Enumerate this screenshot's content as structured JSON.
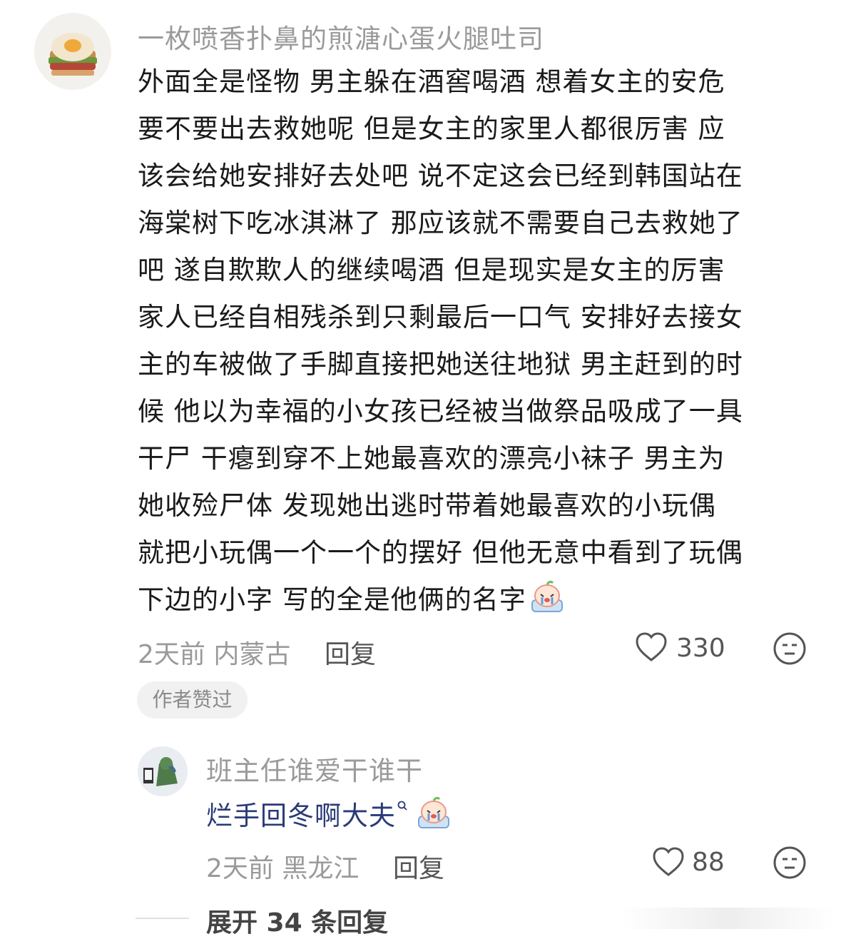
{
  "main_comment": {
    "username": "一枚喷香扑鼻的煎溏心蛋火腿吐司",
    "text_lines": [
      "外面全是怪物  男主躲在酒窖喝酒  想着女主的安危",
      "要不要出去救她呢  但是女主的家里人都很厉害  应",
      "该会给她安排好去处吧  说不定这会已经到韩国站在",
      "海棠树下吃冰淇淋了  那应该就不需要自己去救她了",
      "吧  遂自欺欺人的继续喝酒  但是现实是女主的厉害",
      "家人已经自相残杀到只剩最后一口气  安排好去接女",
      "主的车被做了手脚直接把她送往地狱  男主赶到的时",
      "候  他以为幸福的小女孩已经被当做祭品吸成了一具",
      "干尸  干瘪到穿不上她最喜欢的漂亮小袜子  男主为",
      "她收殓尸体  发现她出逃时带着她最喜欢的小玩偶",
      "就把小玩偶一个一个的摆好  但他无意中看到了玩偶",
      "下边的小字  写的全是他俩的名字"
    ],
    "time": "2天前",
    "location": "内蒙古",
    "reply_label": "回复",
    "likes": "330",
    "author_liked_badge": "作者赞过"
  },
  "sub_reply": {
    "username": "班主任谁爱干谁干",
    "text": "烂手回冬啊大夫",
    "time": "2天前",
    "location": "黑龙江",
    "reply_label": "回复",
    "likes": "88"
  },
  "expand": {
    "label": "展开 34 条回复"
  },
  "colors": {
    "meta_gray": "#9a9a9a",
    "reply_blue": "#2a3a78"
  }
}
